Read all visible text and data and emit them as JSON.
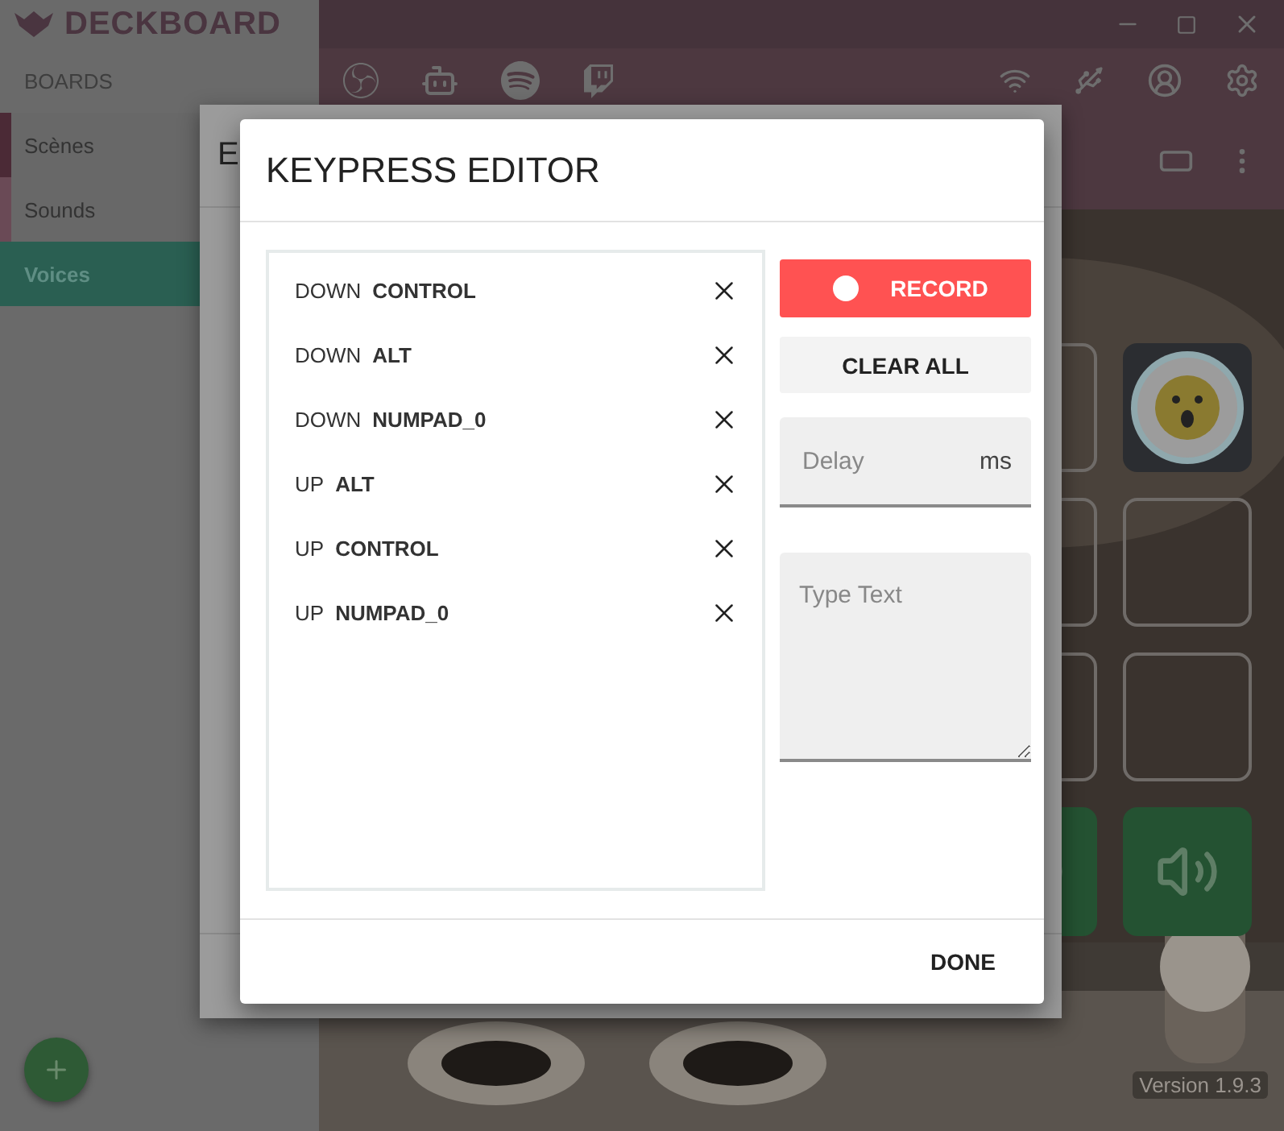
{
  "app": {
    "title": "DECKBOARD",
    "version": "Version 1.9.3"
  },
  "sidebar": {
    "heading": "BOARDS",
    "boards": [
      {
        "label": "Scènes",
        "selected": false,
        "color": "#4b2a36"
      },
      {
        "label": "Sounds",
        "selected": false,
        "color": "#6a4a56"
      },
      {
        "label": "Voices",
        "selected": true,
        "color": "#2a5f52"
      }
    ]
  },
  "background_dialog": {
    "title": "E"
  },
  "dialog": {
    "title": "KEYPRESS EDITOR",
    "events": [
      {
        "direction": "DOWN",
        "key": "CONTROL"
      },
      {
        "direction": "DOWN",
        "key": "ALT"
      },
      {
        "direction": "DOWN",
        "key": "NUMPAD_0"
      },
      {
        "direction": "UP",
        "key": "ALT"
      },
      {
        "direction": "UP",
        "key": "CONTROL"
      },
      {
        "direction": "UP",
        "key": "NUMPAD_0"
      }
    ],
    "record_button": "RECORD",
    "clear_button": "CLEAR ALL",
    "delay_field": {
      "placeholder": "Delay",
      "unit": "ms"
    },
    "text_field": {
      "placeholder": "Type Text"
    },
    "done_button": "DONE"
  }
}
